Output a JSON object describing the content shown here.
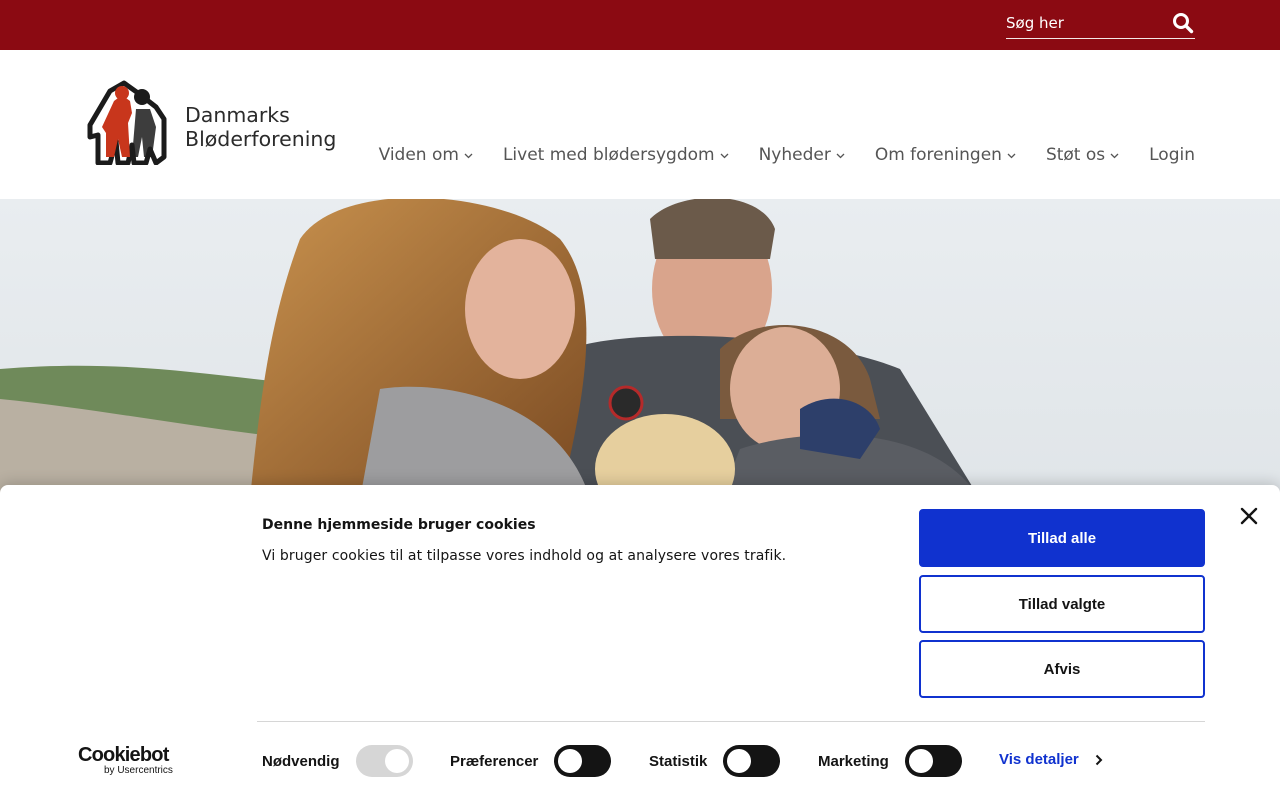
{
  "colors": {
    "brand_red": "#8b0a12",
    "primary_blue": "#1032cf",
    "nav_text": "#555555",
    "toggle_dark": "#141414",
    "toggle_disabled": "#d6d6d6"
  },
  "search": {
    "placeholder": "Søg her",
    "icon": "search-icon"
  },
  "logo": {
    "line1": "Danmarks",
    "line2": "Bløderforening"
  },
  "nav": {
    "items": [
      {
        "label": "Viden om",
        "has_dropdown": true
      },
      {
        "label": "Livet med blødersygdom",
        "has_dropdown": true
      },
      {
        "label": "Nyheder",
        "has_dropdown": true
      },
      {
        "label": "Om foreningen",
        "has_dropdown": true
      },
      {
        "label": "Støt os",
        "has_dropdown": true
      },
      {
        "label": "Login",
        "has_dropdown": false
      }
    ]
  },
  "cookie": {
    "title": "Denne hjemmeside bruger cookies",
    "text": "Vi bruger cookies til at tilpasse vores indhold og at analysere vores trafik.",
    "allow_all": "Tillad alle",
    "allow_selected": "Tillad valgte",
    "deny": "Afvis",
    "details": "Vis detaljer",
    "brand_main": "Cookiebot",
    "brand_sub": "by Usercentrics",
    "toggles": [
      {
        "label": "Nødvendig",
        "on": true,
        "disabled": true
      },
      {
        "label": "Præferencer",
        "on": false,
        "disabled": false
      },
      {
        "label": "Statistik",
        "on": false,
        "disabled": false
      },
      {
        "label": "Marketing",
        "on": false,
        "disabled": false
      }
    ]
  }
}
